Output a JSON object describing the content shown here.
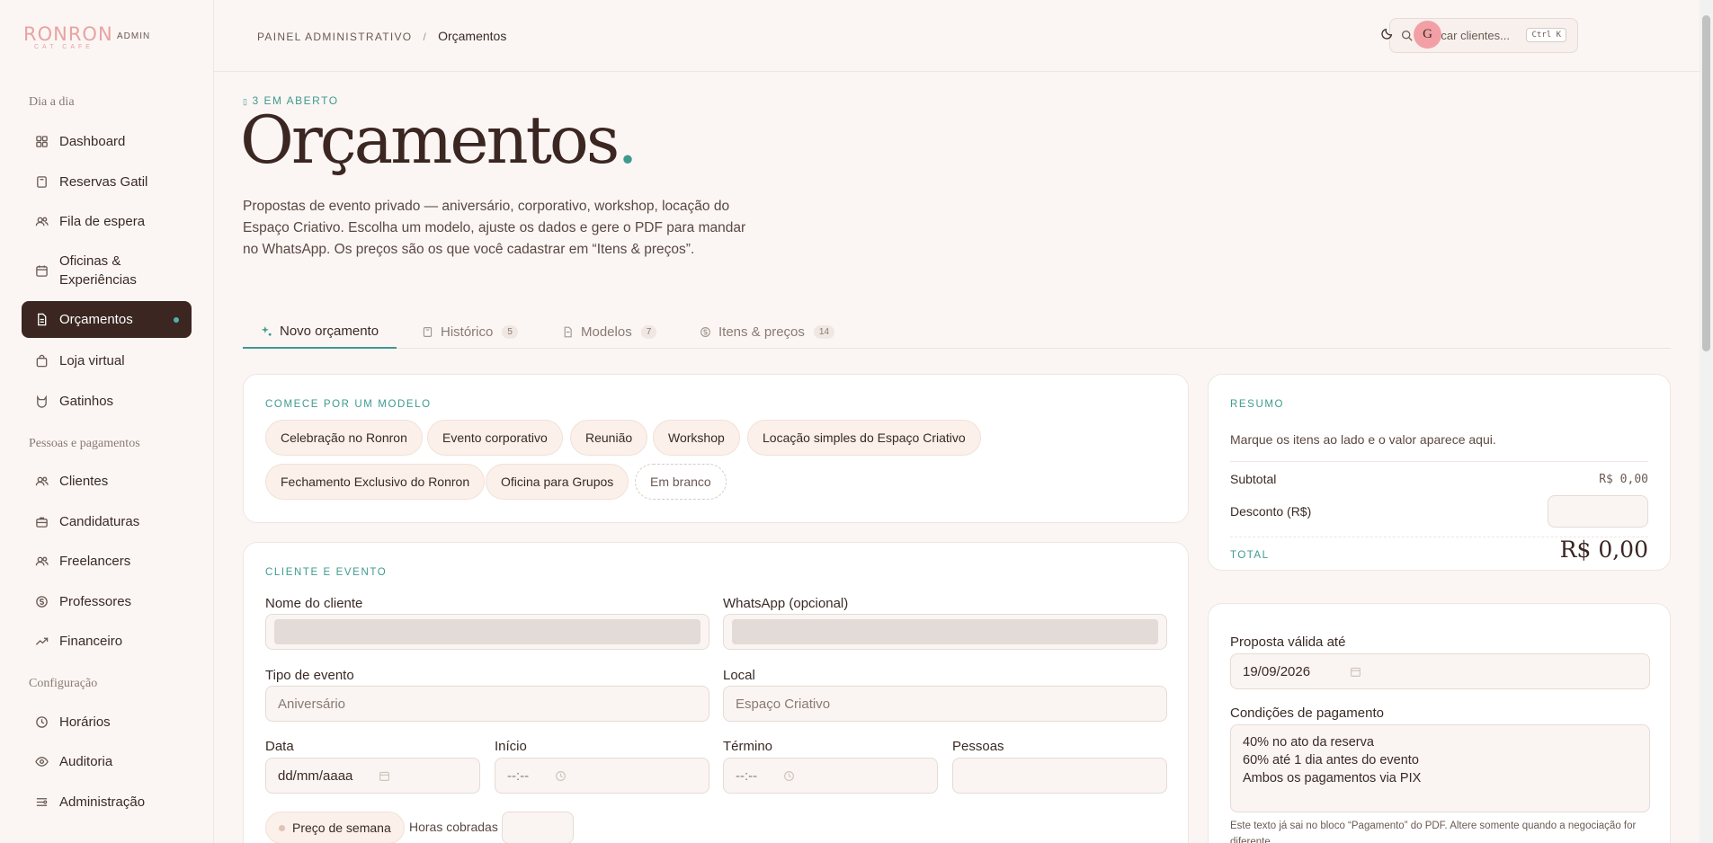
{
  "brand": {
    "name": "RONRON",
    "sub": "CAT CAFE",
    "tag": "ADMIN"
  },
  "sidebar": {
    "sections": [
      {
        "label": "Dia a dia"
      },
      {
        "label": "Pessoas e pagamentos"
      },
      {
        "label": "Configuração"
      }
    ],
    "items": [
      {
        "label": "Dashboard",
        "icon": "grid-icon"
      },
      {
        "label": "Reservas Gatil",
        "icon": "book-icon"
      },
      {
        "label": "Fila de espera",
        "icon": "users-icon"
      },
      {
        "label": "Oficinas &\nExperiências",
        "icon": "calendar-icon"
      },
      {
        "label": "Orçamentos",
        "icon": "document-icon"
      },
      {
        "label": "Loja virtual",
        "icon": "bag-icon"
      },
      {
        "label": "Gatinhos",
        "icon": "cat-icon"
      },
      {
        "label": "Clientes",
        "icon": "users-icon"
      },
      {
        "label": "Candidaturas",
        "icon": "briefcase-icon"
      },
      {
        "label": "Freelancers",
        "icon": "users-icon"
      },
      {
        "label": "Professores",
        "icon": "coin-icon"
      },
      {
        "label": "Financeiro",
        "icon": "trend-icon"
      },
      {
        "label": "Horários",
        "icon": "clock-icon"
      },
      {
        "label": "Auditoria",
        "icon": "eye-icon"
      },
      {
        "label": "Administração",
        "icon": "sliders-icon"
      }
    ]
  },
  "topbar": {
    "breadcrumb_root": "PAINEL ADMINISTRATIVO",
    "breadcrumb_sep": "/",
    "breadcrumb_current": "Orçamentos",
    "search_placeholder": "Buscar clientes...",
    "search_shortcut": "Ctrl K",
    "avatar_initial": "G"
  },
  "page": {
    "eyebrow": "3 EM ABERTO",
    "title": "Orçamentos",
    "title_dot": ".",
    "intro": "Propostas de evento privado — aniversário, corporativo, workshop, locação do Espaço Criativo. Escolha um modelo, ajuste os dados e gere o PDF para mandar no WhatsApp. Os preços são os que você cadastrar em “Itens & preços”."
  },
  "tabs": [
    {
      "label": "Novo orçamento",
      "badge": ""
    },
    {
      "label": "Histórico",
      "badge": "5"
    },
    {
      "label": "Modelos",
      "badge": "7"
    },
    {
      "label": "Itens & preços",
      "badge": "14"
    }
  ],
  "templates": {
    "heading": "COMECE POR UM MODELO",
    "chips": [
      "Celebração no Ronron",
      "Evento corporativo",
      "Reunião",
      "Workshop",
      "Locação simples do Espaço Criativo",
      "Fechamento Exclusivo do Ronron",
      "Oficina para Grupos",
      "Em branco"
    ]
  },
  "client": {
    "heading": "CLIENTE E EVENTO",
    "name_label": "Nome do cliente",
    "whatsapp_label": "WhatsApp (opcional)",
    "event_type_label": "Tipo de evento",
    "event_type_placeholder": "Aniversário",
    "location_label": "Local",
    "location_placeholder": "Espaço Criativo",
    "date_label": "Data",
    "date_placeholder": "dd/mm/aaaa",
    "start_label": "Início",
    "start_placeholder": "--:--",
    "end_label": "Término",
    "end_placeholder": "--:--",
    "people_label": "Pessoas",
    "week_price_label": "Preço de semana",
    "hours_label": "Horas cobradas"
  },
  "summary": {
    "heading": "RESUMO",
    "hint": "Marque os itens ao lado e o valor aparece aqui.",
    "subtotal_label": "Subtotal",
    "subtotal_value": "R$ 0,00",
    "discount_label": "Desconto (R$)",
    "total_label": "TOTAL",
    "total_value": "R$ 0,00"
  },
  "proposal": {
    "valid_label": "Proposta válida até",
    "valid_value": "19/09/2026",
    "payment_label": "Condições de pagamento",
    "payment_value": "40% no ato da reserva\n60% até 1 dia antes do evento\nAmbos os pagamentos via PIX",
    "payment_note": "Este texto já sai no bloco “Pagamento” do PDF. Altere somente quando a negociação for diferente."
  },
  "colors": {
    "accent": "#3e9a90",
    "brand": "#e8a3a3",
    "active_nav": "#3b2622"
  }
}
